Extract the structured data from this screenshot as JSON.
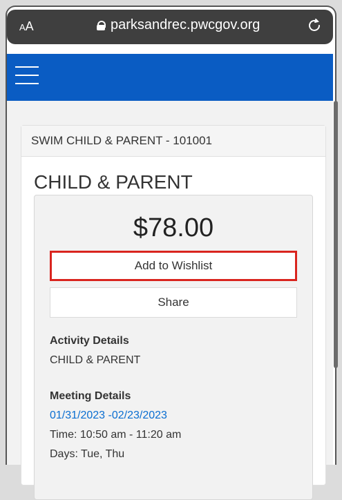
{
  "browser": {
    "aa_label": "AA",
    "url": "parksandrec.pwcgov.org"
  },
  "page": {
    "card_header": "SWIM CHILD & PARENT - 101001",
    "program_title": "CHILD & PARENT",
    "price": "$78.00",
    "buttons": {
      "wishlist": "Add to Wishlist",
      "share": "Share"
    },
    "activity_details": {
      "title": "Activity Details",
      "text": "CHILD & PARENT"
    },
    "meeting_details": {
      "title": "Meeting Details",
      "dates": "01/31/2023 -02/23/2023",
      "time": "Time: 10:50 am - 11:20 am",
      "days": "Days: Tue, Thu"
    }
  }
}
